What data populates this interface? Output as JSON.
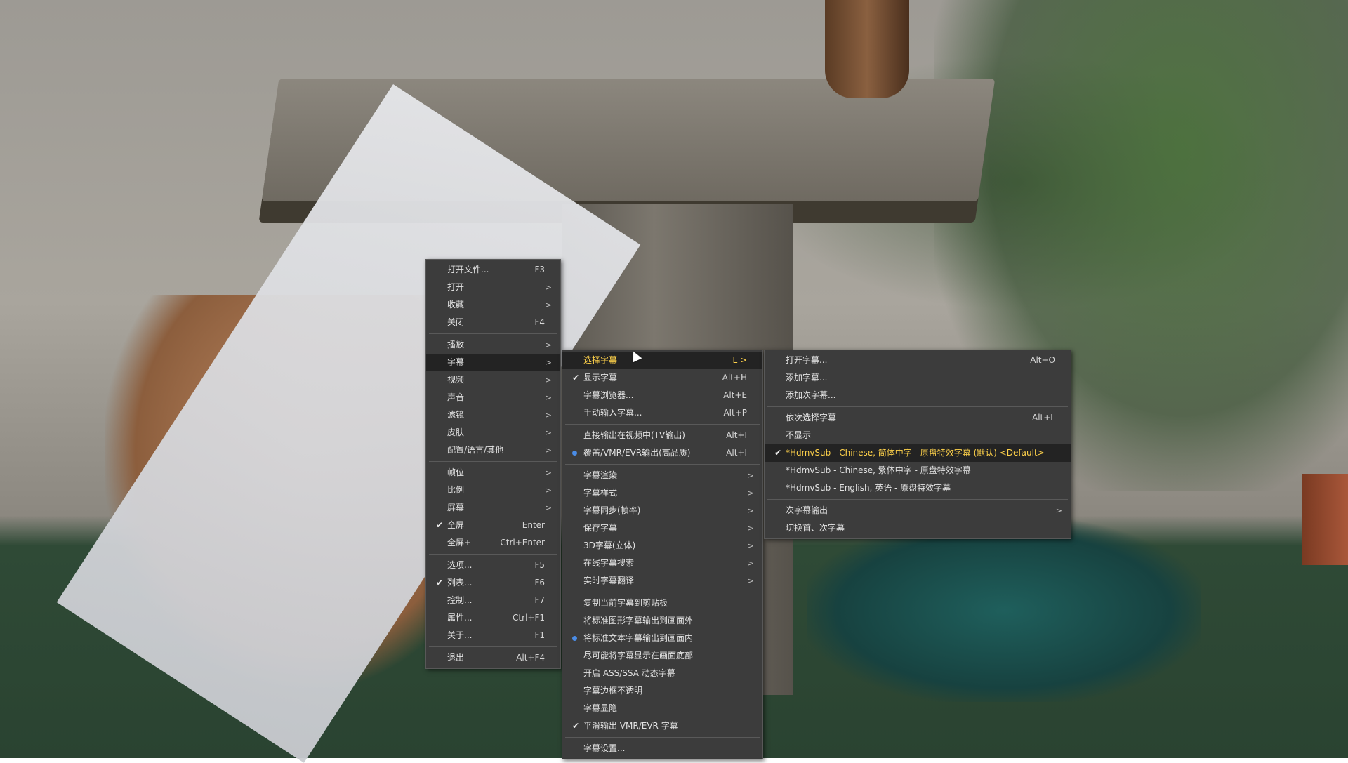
{
  "main_menu": {
    "groups": [
      [
        {
          "label": "打开文件...",
          "shortcut": "F3",
          "submenu": false,
          "check": false
        },
        {
          "label": "打开",
          "shortcut": "",
          "submenu": true,
          "check": false
        },
        {
          "label": "收藏",
          "shortcut": "",
          "submenu": true,
          "check": false
        },
        {
          "label": "关闭",
          "shortcut": "F4",
          "submenu": false,
          "check": false
        }
      ],
      [
        {
          "label": "播放",
          "shortcut": "",
          "submenu": true,
          "check": false
        },
        {
          "label": "字幕",
          "shortcut": "",
          "submenu": true,
          "check": false,
          "highlighted": true
        },
        {
          "label": "视频",
          "shortcut": "",
          "submenu": true,
          "check": false
        },
        {
          "label": "声音",
          "shortcut": "",
          "submenu": true,
          "check": false
        },
        {
          "label": "滤镜",
          "shortcut": "",
          "submenu": true,
          "check": false
        },
        {
          "label": "皮肤",
          "shortcut": "",
          "submenu": true,
          "check": false
        },
        {
          "label": "配置/语言/其他",
          "shortcut": "",
          "submenu": true,
          "check": false
        }
      ],
      [
        {
          "label": "帧位",
          "shortcut": "",
          "submenu": true,
          "check": false
        },
        {
          "label": "比例",
          "shortcut": "",
          "submenu": true,
          "check": false
        },
        {
          "label": "屏幕",
          "shortcut": "",
          "submenu": true,
          "check": false
        },
        {
          "label": "全屏",
          "shortcut": "Enter",
          "submenu": false,
          "check": true
        },
        {
          "label": "全屏+",
          "shortcut": "Ctrl+Enter",
          "submenu": false,
          "check": false
        }
      ],
      [
        {
          "label": "选项...",
          "shortcut": "F5",
          "submenu": false,
          "check": false
        },
        {
          "label": "列表...",
          "shortcut": "F6",
          "submenu": false,
          "check": true
        },
        {
          "label": "控制...",
          "shortcut": "F7",
          "submenu": false,
          "check": false
        },
        {
          "label": "属性...",
          "shortcut": "Ctrl+F1",
          "submenu": false,
          "check": false
        },
        {
          "label": "关于...",
          "shortcut": "F1",
          "submenu": false,
          "check": false
        }
      ],
      [
        {
          "label": "退出",
          "shortcut": "Alt+F4",
          "submenu": false,
          "check": false
        }
      ]
    ]
  },
  "subtitle_menu": {
    "groups": [
      [
        {
          "label": "选择字幕",
          "shortcut": "L >",
          "submenu": false,
          "highlighted": true,
          "selected": true
        },
        {
          "label": "显示字幕",
          "shortcut": "Alt+H",
          "check": true
        },
        {
          "label": "字幕浏览器...",
          "shortcut": "Alt+E"
        },
        {
          "label": "手动输入字幕...",
          "shortcut": "Alt+P"
        }
      ],
      [
        {
          "label": "直接输出在视频中(TV输出)",
          "shortcut": "Alt+I"
        },
        {
          "label": "覆盖/VMR/EVR输出(高品质)",
          "shortcut": "Alt+I",
          "radio": true
        }
      ],
      [
        {
          "label": "字幕渲染",
          "submenu": true
        },
        {
          "label": "字幕样式",
          "submenu": true
        },
        {
          "label": "字幕同步(帧率)",
          "submenu": true
        },
        {
          "label": "保存字幕",
          "submenu": true
        },
        {
          "label": "3D字幕(立体)",
          "submenu": true
        },
        {
          "label": "在线字幕搜索",
          "submenu": true
        },
        {
          "label": "实时字幕翻译",
          "submenu": true
        }
      ],
      [
        {
          "label": "复制当前字幕到剪贴板"
        },
        {
          "label": "将标准图形字幕输出到画面外"
        },
        {
          "label": "将标准文本字幕输出到画面内",
          "radio": true
        },
        {
          "label": "尽可能将字幕显示在画面底部"
        },
        {
          "label": "开启 ASS/SSA 动态字幕"
        },
        {
          "label": "字幕边框不透明"
        },
        {
          "label": "字幕显隐"
        },
        {
          "label": "平滑输出 VMR/EVR 字幕",
          "check": true
        }
      ],
      [
        {
          "label": "字幕设置..."
        }
      ]
    ]
  },
  "select_subtitle_menu": {
    "groups": [
      [
        {
          "label": "打开字幕...",
          "shortcut": "Alt+O"
        },
        {
          "label": "添加字幕..."
        },
        {
          "label": "添加次字幕..."
        }
      ],
      [
        {
          "label": "依次选择字幕",
          "shortcut": "Alt+L"
        },
        {
          "label": "不显示"
        },
        {
          "label": "*HdmvSub - Chinese, 简体中字 - 原盘特效字幕 (默认) <Default>",
          "check": true,
          "highlighted": true,
          "selected": true
        },
        {
          "label": "*HdmvSub - Chinese, 繁体中字 - 原盘特效字幕"
        },
        {
          "label": "*HdmvSub - English, 英语 - 原盘特效字幕"
        }
      ],
      [
        {
          "label": "次字幕输出",
          "submenu": true
        },
        {
          "label": "切换首、次字幕"
        }
      ]
    ]
  },
  "colors": {
    "menu_bg": "#3c3c3c",
    "highlight_bg": "#232323",
    "selected_text": "#ffd24a",
    "text": "#e2e2e2",
    "radio": "#4a8ce6"
  }
}
